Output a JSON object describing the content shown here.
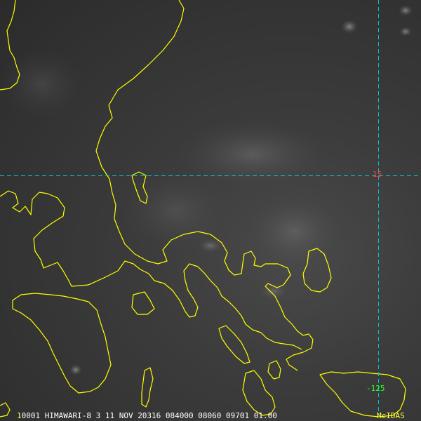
{
  "map": {
    "colors": {
      "coastline": "#ffff00",
      "latlon_grid": "#00c8c8",
      "latitude_label": "#ff4040",
      "longitude_label": "#30ff30",
      "frame_number": "#ffff40",
      "status_text": "#ffffff"
    },
    "grid": {
      "latitude_label": "15",
      "longitude_label": "-125"
    }
  },
  "status_bar": {
    "frame": "1",
    "text": "0001 HIMAWARI-8   3 11 NOV 20316 084000 08060 09701 01.00",
    "logo": "McIDAS"
  }
}
